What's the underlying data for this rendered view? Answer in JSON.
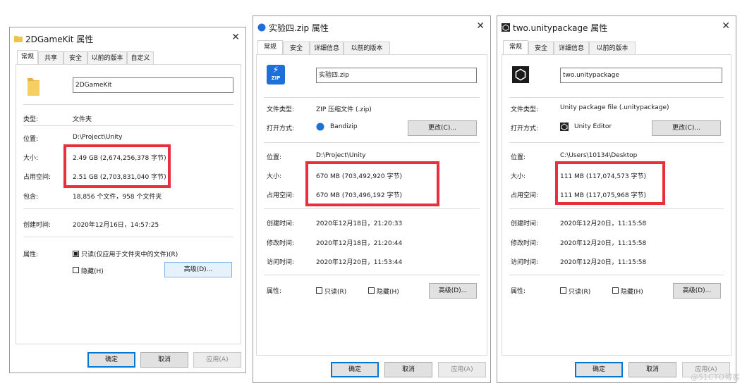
{
  "dialogs": [
    {
      "title": "2DGameKit 属性",
      "tabs": [
        "常规",
        "共享",
        "安全",
        "以前的版本",
        "自定义"
      ],
      "name": "2DGameKit",
      "type_label": "类型:",
      "type_value": "文件夹",
      "location_label": "位置:",
      "location_value": "D:\\Project\\Unity",
      "size_label": "大小:",
      "size_value": "2.49 GB (2,674,256,378 字节)",
      "disk_label": "占用空间:",
      "disk_value": "2.51 GB (2,703,831,040 字节)",
      "contains_label": "包含:",
      "contains_value": "18,856 个文件，958 个文件夹",
      "created_label": "创建时间:",
      "created_value": "2020年12月16日，14:57:25",
      "attr_label": "属性:",
      "readonly_label": "只读(仅应用于文件夹中的文件)(R)",
      "hidden_label": "隐藏(H)",
      "advanced_label": "高级(D)...",
      "ok": "确定",
      "cancel": "取消",
      "apply": "应用(A)"
    },
    {
      "title": "实验四.zip 属性",
      "tabs": [
        "常规",
        "安全",
        "详细信息",
        "以前的版本"
      ],
      "name": "实验四.zip",
      "filetype_label": "文件类型:",
      "filetype_value": "ZIP 压缩文件 (.zip)",
      "openwith_label": "打开方式:",
      "openwith_value": "Bandizip",
      "change_label": "更改(C)...",
      "location_label": "位置:",
      "location_value": "D:\\Project\\Unity",
      "size_label": "大小:",
      "size_value": "670 MB (703,492,920 字节)",
      "disk_label": "占用空间:",
      "disk_value": "670 MB (703,496,192 字节)",
      "created_label": "创建时间:",
      "created_value": "2020年12月18日，21:20:33",
      "modified_label": "修改时间:",
      "modified_value": "2020年12月18日，21:20:44",
      "accessed_label": "访问时间:",
      "accessed_value": "2020年12月20日，11:53:44",
      "attr_label": "属性:",
      "readonly_label": "只读(R)",
      "hidden_label": "隐藏(H)",
      "advanced_label": "高级(D)...",
      "ok": "确定",
      "cancel": "取消",
      "apply": "应用(A)"
    },
    {
      "title": "two.unitypackage 属性",
      "tabs": [
        "常规",
        "安全",
        "详细信息",
        "以前的版本"
      ],
      "name": "two.unitypackage",
      "filetype_label": "文件类型:",
      "filetype_value": "Unity package file (.unitypackage)",
      "openwith_label": "打开方式:",
      "openwith_value": "Unity Editor",
      "change_label": "更改(C)...",
      "location_label": "位置:",
      "location_value": "C:\\Users\\10134\\Desktop",
      "size_label": "大小:",
      "size_value": "111 MB (117,074,573 字节)",
      "disk_label": "占用空间:",
      "disk_value": "111 MB (117,075,968 字节)",
      "created_label": "创建时间:",
      "created_value": "2020年12月20日，11:15:58",
      "modified_label": "修改时间:",
      "modified_value": "2020年12月20日，11:15:58",
      "accessed_label": "访问时间:",
      "accessed_value": "2020年12月20日，11:15:58",
      "attr_label": "属性:",
      "readonly_label": "只读(R)",
      "hidden_label": "隐藏(H)",
      "advanced_label": "高级(D)...",
      "ok": "确定",
      "cancel": "取消",
      "apply": "应用(A)"
    }
  ],
  "zip_icon_text": "ZIP",
  "watermark": "@51CTO博客",
  "colors": {
    "highlight": "#e8303a",
    "accent": "#0078d7",
    "folder": "#f2c14e"
  }
}
